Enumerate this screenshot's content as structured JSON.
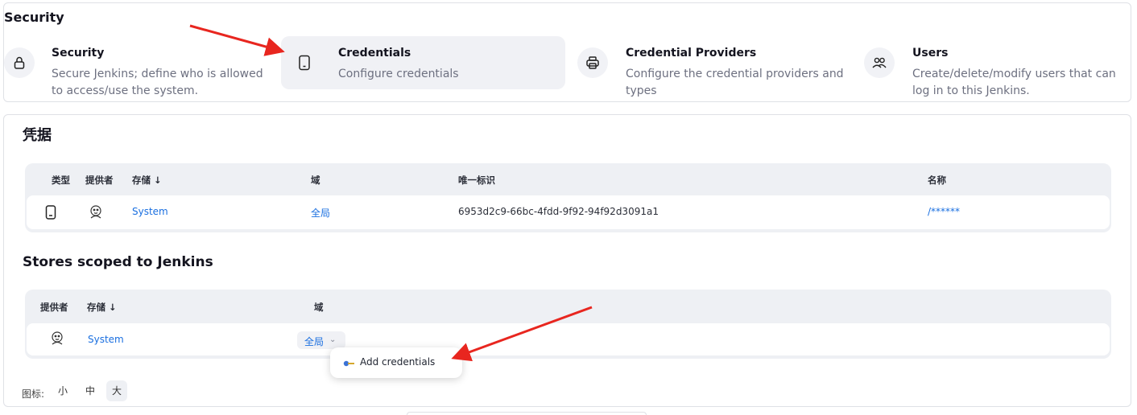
{
  "security": {
    "section_title": "Security",
    "categories": [
      {
        "title": "Security",
        "desc": "Secure Jenkins; define who is allowed to access/use the system.",
        "icon": "lock-icon"
      },
      {
        "title": "Credentials",
        "desc": "Configure credentials",
        "icon": "phone-icon"
      },
      {
        "title": "Credential Providers",
        "desc": "Configure the credential providers and types",
        "icon": "printer-icon"
      },
      {
        "title": "Users",
        "desc": "Create/delete/modify users that can log in to this Jenkins.",
        "icon": "users-icon"
      }
    ]
  },
  "credentials": {
    "heading": "凭据",
    "columns": {
      "type": "类型",
      "provider": "提供者",
      "store": "存储 ↓",
      "domain": "域",
      "id": "唯一标识",
      "name": "名称"
    },
    "rows": [
      {
        "store": "System",
        "domain": "全局",
        "id": "6953d2c9-66bc-4fdd-9f92-94f92d3091a1",
        "name": "/******"
      }
    ]
  },
  "stores": {
    "heading": "Stores scoped to Jenkins",
    "columns": {
      "provider": "提供者",
      "store": "存储 ↓",
      "domain": "域"
    },
    "rows": [
      {
        "store": "System",
        "domain": "全局"
      }
    ],
    "dropdown_menu": {
      "item": "Add credentials"
    }
  },
  "icon_size": {
    "label": "图标:",
    "options": [
      "小",
      "中",
      "大"
    ],
    "selected": "大"
  },
  "colors": {
    "link": "#1a6fe0",
    "arrow": "#e8261f",
    "panel_bg": "#eef0f4"
  }
}
